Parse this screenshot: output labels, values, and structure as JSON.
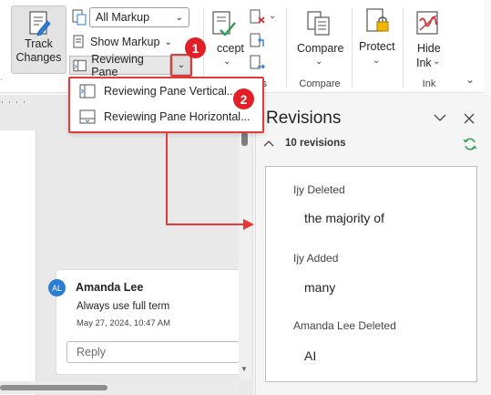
{
  "ribbon": {
    "track_changes_label_1": "Track",
    "track_changes_label_2": "Changes",
    "track_changes_arrow": "⌄",
    "markup_select": "All Markup",
    "show_markup": "Show Markup",
    "reviewing_pane": "Reviewing Pane",
    "accept_label": "ccept",
    "changes_group": "Changes",
    "compare_label": "Compare",
    "compare_group": "Compare",
    "protect_label": "Protect",
    "hide_ink_label_1": "Hide",
    "hide_ink_label_2": "Ink",
    "ink_group": "Ink"
  },
  "menu": {
    "items": [
      {
        "label": "Reviewing Pane Vertical..."
      },
      {
        "label": "Reviewing Pane Horizontal..."
      }
    ]
  },
  "callouts": {
    "first": "1",
    "second": "2"
  },
  "comment": {
    "avatar_initials": "AL",
    "author": "Amanda Lee",
    "text": "Always use full term",
    "date": "May 27, 2024, 10:47 AM",
    "reply_placeholder": "Reply"
  },
  "pane": {
    "title": "Revisions",
    "count": "10 revisions",
    "revisions": [
      {
        "meta": "Ijy Deleted",
        "text": "the majority of"
      },
      {
        "meta": "Ijy Added",
        "text": "many"
      },
      {
        "meta": "Amanda Lee Deleted",
        "text": "AI"
      }
    ]
  },
  "colors": {
    "callout": "#e21f26",
    "annotation_red": "#e03a3a",
    "avatar_blue": "#2b7cd3",
    "refresh_green": "#2e9e4f"
  }
}
